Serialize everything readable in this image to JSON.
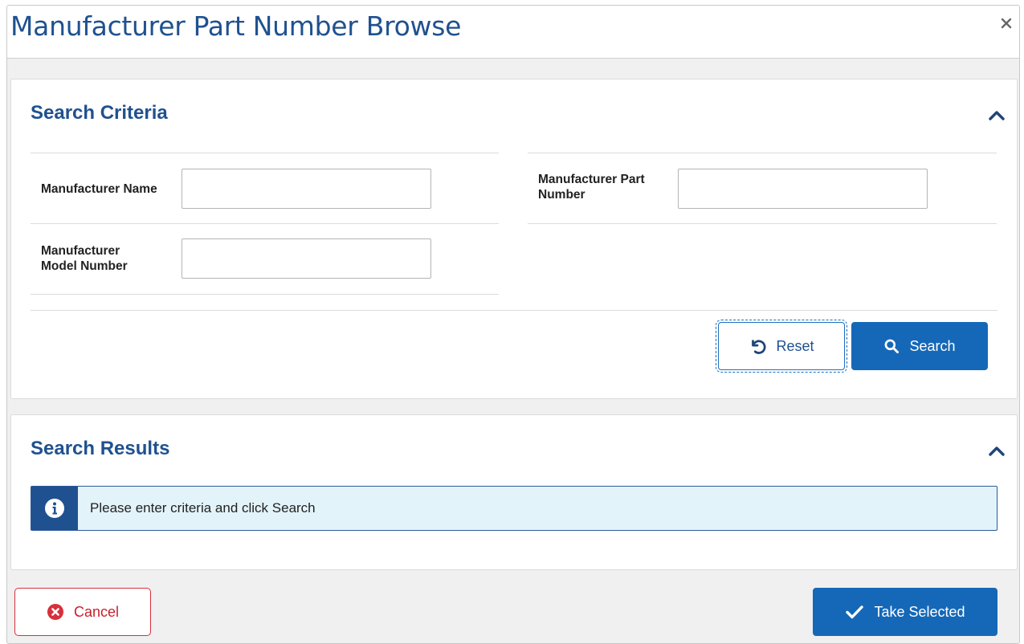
{
  "modal": {
    "title": "Manufacturer Part Number Browse",
    "close_icon": "close-icon"
  },
  "search_criteria": {
    "title": "Search Criteria",
    "collapse_icon": "chevron-up-icon",
    "fields": {
      "manufacturer_name": {
        "label": "Manufacturer Name",
        "value": ""
      },
      "manufacturer_part_number": {
        "label_line1": "Manufacturer Part",
        "label_line2": "Number",
        "value": ""
      },
      "manufacturer_model_number": {
        "label_line1": "Manufacturer",
        "label_line2": "Model Number",
        "value": ""
      }
    },
    "reset_label": "Reset",
    "reset_icon": "undo-icon",
    "search_label": "Search",
    "search_icon": "search-icon"
  },
  "search_results": {
    "title": "Search Results",
    "collapse_icon": "chevron-up-icon",
    "alert_icon": "info-icon",
    "alert_text": "Please enter criteria and click Search"
  },
  "footer": {
    "cancel_label": "Cancel",
    "cancel_icon": "times-circle-icon",
    "take_selected_label": "Take Selected",
    "take_selected_icon": "check-icon"
  },
  "colors": {
    "brand_blue": "#1f5190",
    "button_blue": "#1568b8",
    "cancel_red": "#c8202c",
    "alert_bg": "#e3f3fa"
  }
}
